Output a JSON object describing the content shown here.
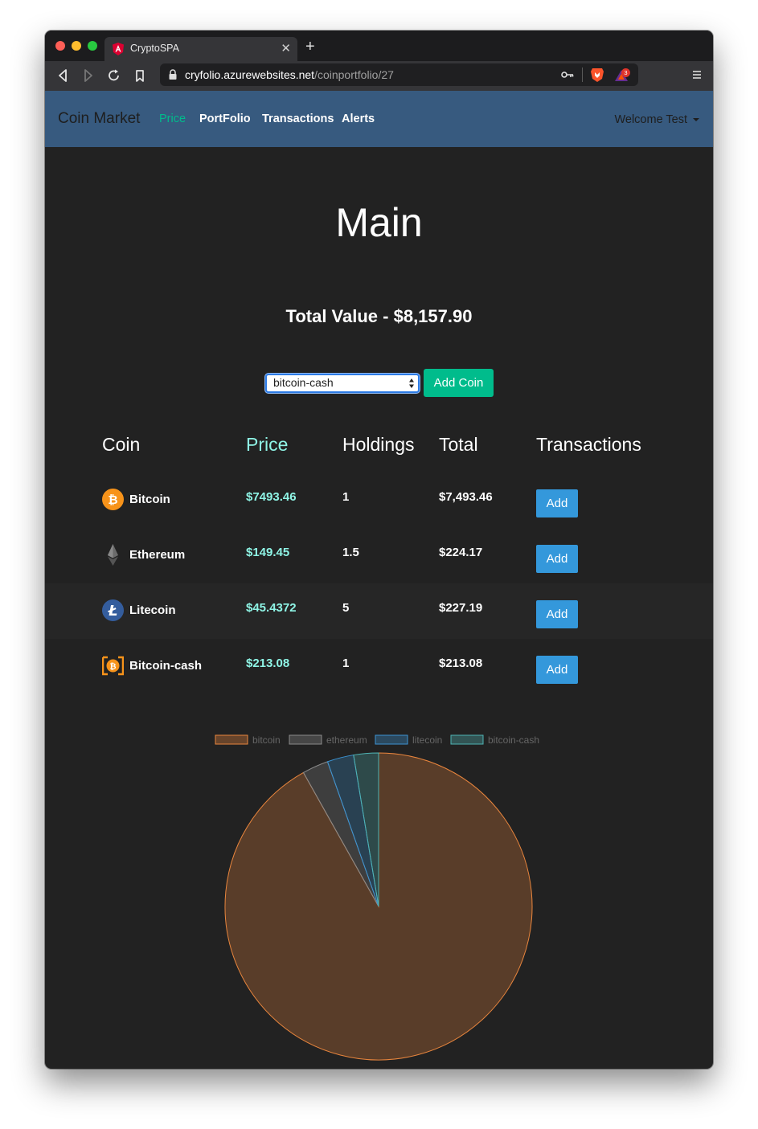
{
  "browser": {
    "tab_title": "CryptoSPA",
    "url_domain": "cryfolio.azurewebsites.net",
    "url_path": "/coinportfolio/27",
    "notification_count": "3"
  },
  "navbar": {
    "brand": "Coin Market",
    "links": [
      "Price",
      "PortFolio",
      "Transactions",
      "Alerts"
    ],
    "active_link": "Price",
    "user_menu": "Welcome Test"
  },
  "page": {
    "title": "Main",
    "total_value": "Total Value - $8,157.90"
  },
  "add_coin": {
    "selected": "bitcoin-cash",
    "button_label": "Add Coin"
  },
  "table": {
    "headers": [
      "Coin",
      "Price",
      "Holdings",
      "Total",
      "Transactions"
    ],
    "rows": [
      {
        "name": "Bitcoin",
        "price": "$7493.46",
        "holdings": "1",
        "total": "$7,493.46",
        "action": "Add",
        "icon": "bitcoin-icon"
      },
      {
        "name": "Ethereum",
        "price": "$149.45",
        "holdings": "1.5",
        "total": "$224.17",
        "action": "Add",
        "icon": "ethereum-icon"
      },
      {
        "name": "Litecoin",
        "price": "$45.4372",
        "holdings": "5",
        "total": "$227.19",
        "action": "Add",
        "icon": "litecoin-icon"
      },
      {
        "name": "Bitcoin-cash",
        "price": "$213.08",
        "holdings": "1",
        "total": "$213.08",
        "action": "Add",
        "icon": "bitcoin-cash-icon"
      }
    ]
  },
  "colors": {
    "navbar": "#375a7f",
    "success": "#00bc8c",
    "info": "#3498db",
    "price_text": "#8ff5e6",
    "background": "#222222"
  },
  "chart_data": {
    "type": "pie",
    "labels": [
      "bitcoin",
      "ethereum",
      "litecoin",
      "bitcoin-cash"
    ],
    "values": [
      7493.46,
      224.17,
      227.19,
      213.08
    ],
    "colors": [
      "#e8853d",
      "#8a8a8a",
      "#3c93d2",
      "#4fb3b3"
    ],
    "legend": "top"
  }
}
